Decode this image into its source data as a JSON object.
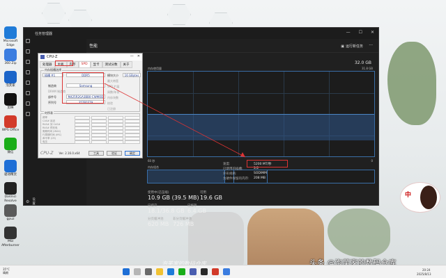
{
  "desktop_icons": [
    {
      "label": "Microsoft Edge",
      "color": "#1f7bd8"
    },
    {
      "label": "360 Zip",
      "color": "#3b7de0"
    },
    {
      "label": "泡芙家",
      "color": "#1a65c9"
    },
    {
      "label": "剪映",
      "color": "#111111"
    },
    {
      "label": "WPS Office",
      "color": "#d23a2a"
    },
    {
      "label": "微信",
      "color": "#1aad19"
    },
    {
      "label": "驱动精灵",
      "color": "#1e6fd6"
    },
    {
      "label": "DaVinci Resolve",
      "color": "#222222"
    },
    {
      "label": "gpuz",
      "color": "#5a5a5a"
    },
    {
      "label": "MSI Afterburner",
      "color": "#333333"
    }
  ],
  "task_manager": {
    "window_title": "任务管理器",
    "section": "性能",
    "run_new_task": "运行新任务",
    "memory_title": "内存",
    "memory_total": "32.0 GB",
    "graph_label_top_right": "31.8 GB",
    "graph_label_left": "内存使用量",
    "graph_time": "60 秒",
    "graph_zero": "0",
    "composition_label": "内存组合",
    "in_use_label": "使用中(已压缩)",
    "in_use_value": "10.9 GB (39.5 MB)",
    "available_label": "可用",
    "available_value": "19.6 GB",
    "committed_label": "已提交",
    "committed_value": "18.1/36.8 GB",
    "cached_label": "已缓存",
    "cached_value": "6.4 GB",
    "paged_pool_label": "分页缓冲池",
    "paged_pool_value": "620 MB",
    "nonpaged_pool_label": "非分页缓冲池",
    "nonpaged_pool_value": "726 MB",
    "specs": [
      {
        "k": "速度:",
        "v": "5200 MT/秒"
      },
      {
        "k": "已使用的插槽:",
        "v": "2/2"
      },
      {
        "k": "外形规格:",
        "v": "SODIMM"
      },
      {
        "k": "为硬件保留的内存:",
        "v": "208 MB"
      }
    ],
    "side_label_settings": "设置",
    "ctrl_min": "—",
    "ctrl_max": "☐",
    "ctrl_close": "✕",
    "more_symbol": "···"
  },
  "cpuz": {
    "title": "CPU-Z",
    "tabs": [
      "处理器",
      "主板",
      "内存",
      "SPD",
      "显卡",
      "测试分数",
      "关于"
    ],
    "selected_tab": "SPD",
    "group_label": "内存插槽选择",
    "slot_value": "插槽 #1",
    "type_value": "DDR5",
    "module_size_label": "模块大小",
    "module_size_value": "16 GBytes",
    "max_bw_label": "最大带宽",
    "spd_ext_label": "SPD 扩展",
    "week_year_label": "周数/年份",
    "manufacturer_label": "制造商",
    "manufacturer_value": "Samsung",
    "dram_mfr_label": "DRAM 制造商",
    "part_label": "部件号",
    "part_value": "M425R2GA3BB0-CWMOD",
    "serial_label": "序列号",
    "serial_value": "357B1F79",
    "bank_label": "内存块数",
    "correction_label": "校验",
    "registered_label": "已注册",
    "timing_group_label": "时序表",
    "timing_rows": [
      "频率",
      "CAS# 延迟",
      "RAS# 到 CAS#",
      "RAS# 预充电",
      "周期时间 (tRAS)",
      "行周期时间 (tRC)",
      "命令率 (CR)",
      "电压"
    ],
    "brand": "CPU-Z",
    "version": "Ver. 2.16.0.x64",
    "tools_button": "工具",
    "validate_button": "验证",
    "ok_button": "确定"
  },
  "watermark": "头条 @泡芙家的数码仓库",
  "watermark2": "泡芙家的数码仓库",
  "sticker_text": "中",
  "taskbar": {
    "weather_temp": "35°C",
    "weather_desc": "晴朗",
    "time": "20:24",
    "date": "2025/8/13"
  }
}
